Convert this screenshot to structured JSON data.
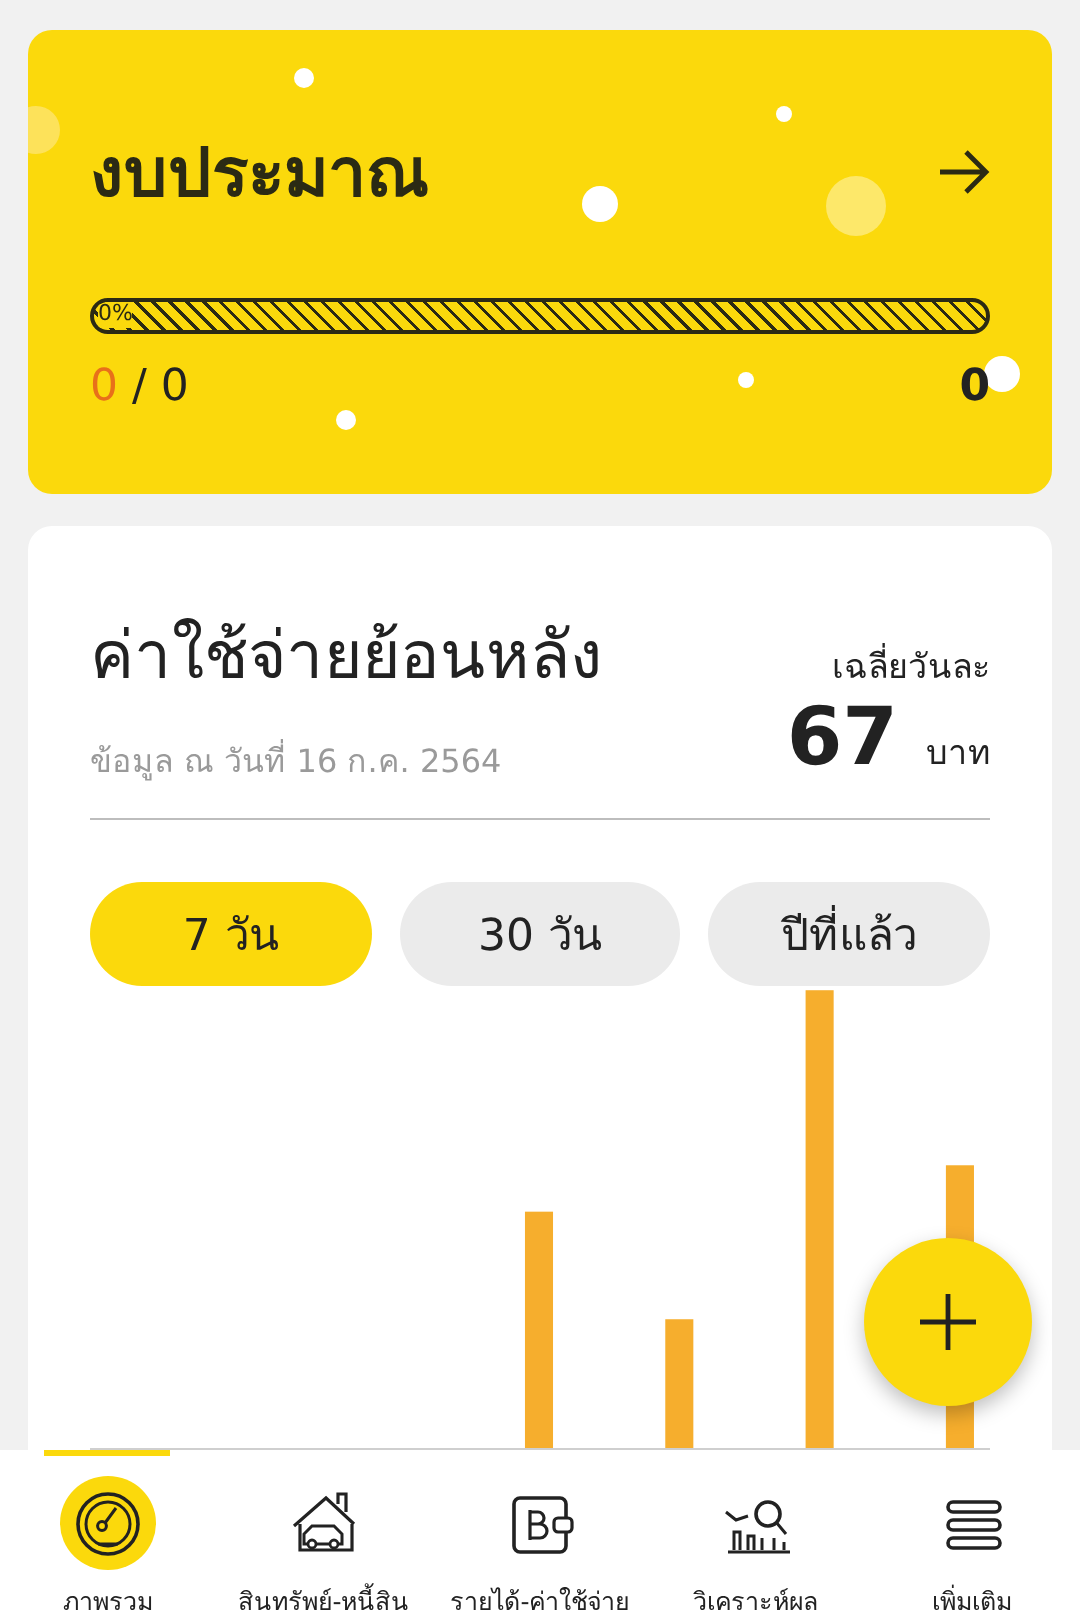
{
  "budget": {
    "title": "งบประมาณ",
    "progress": {
      "label": "0%",
      "level": 0
    },
    "used": "0",
    "separator": "/",
    "total": "0",
    "remaining": "0"
  },
  "history": {
    "title": "ค่าใช้จ่ายย้อนหลัง",
    "subtitle": "ข้อมูล ณ วันที่ 16 ก.ค. 2564",
    "average_label": "เฉลี่ยวันละ",
    "average_value": "67",
    "unit": "บาท",
    "ranges": [
      {
        "label": "7 วัน",
        "selected": true
      },
      {
        "label": "30 วัน",
        "selected": false
      },
      {
        "label": "ปีที่แล้ว",
        "selected": false
      }
    ]
  },
  "nav": {
    "items": [
      {
        "label": "ภาพรวม",
        "kind": "gauge",
        "selected": true
      },
      {
        "label": "สินทรัพย์-หนี้สิน",
        "kind": "house",
        "selected": false
      },
      {
        "label": "รายได้-ค่าใช้จ่าย",
        "kind": "wallet",
        "selected": false
      },
      {
        "label": "วิเคราะห์ผล",
        "kind": "analysis",
        "selected": false
      },
      {
        "label": "เพิ่มเติม",
        "kind": "menu",
        "selected": false
      }
    ]
  }
}
